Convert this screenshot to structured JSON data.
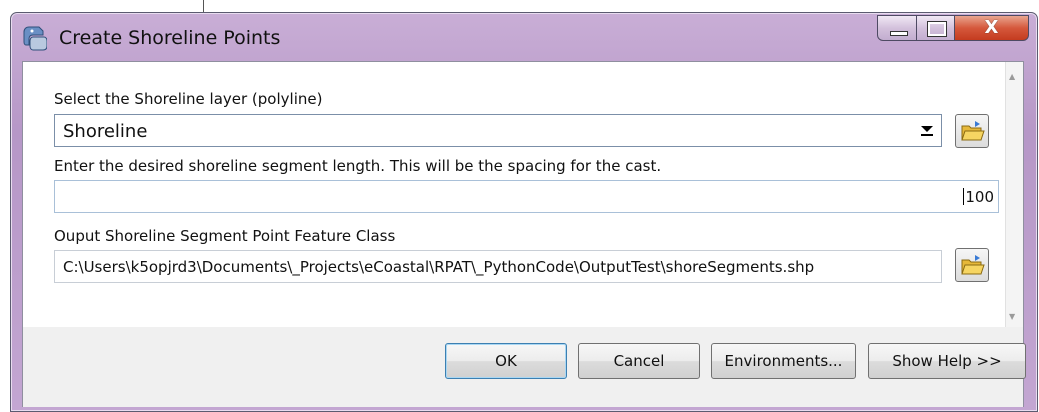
{
  "window": {
    "title": "Create Shoreline Points",
    "title_icon": "python-script-icon",
    "close_glyph": "X"
  },
  "form": {
    "shoreline_layer": {
      "label": "Select the Shoreline layer (polyline)",
      "value": "Shoreline"
    },
    "segment_length": {
      "label": "Enter the desired shoreline segment length.  This will be the spacing for the cast.",
      "value": "100"
    },
    "output_class": {
      "label": "Ouput Shoreline Segment Point Feature Class",
      "value": "C:\\Users\\k5opjrd3\\Documents\\_Projects\\eCoastal\\RPAT\\_PythonCode\\OutputTest\\shoreSegments.shp"
    }
  },
  "buttons": {
    "ok": "OK",
    "cancel": "Cancel",
    "environments": "Environments...",
    "help": "Show Help >>"
  },
  "colors": {
    "frame": "#b697c7",
    "close_button": "#c43b1f",
    "ok_border": "#3c7fb1"
  }
}
